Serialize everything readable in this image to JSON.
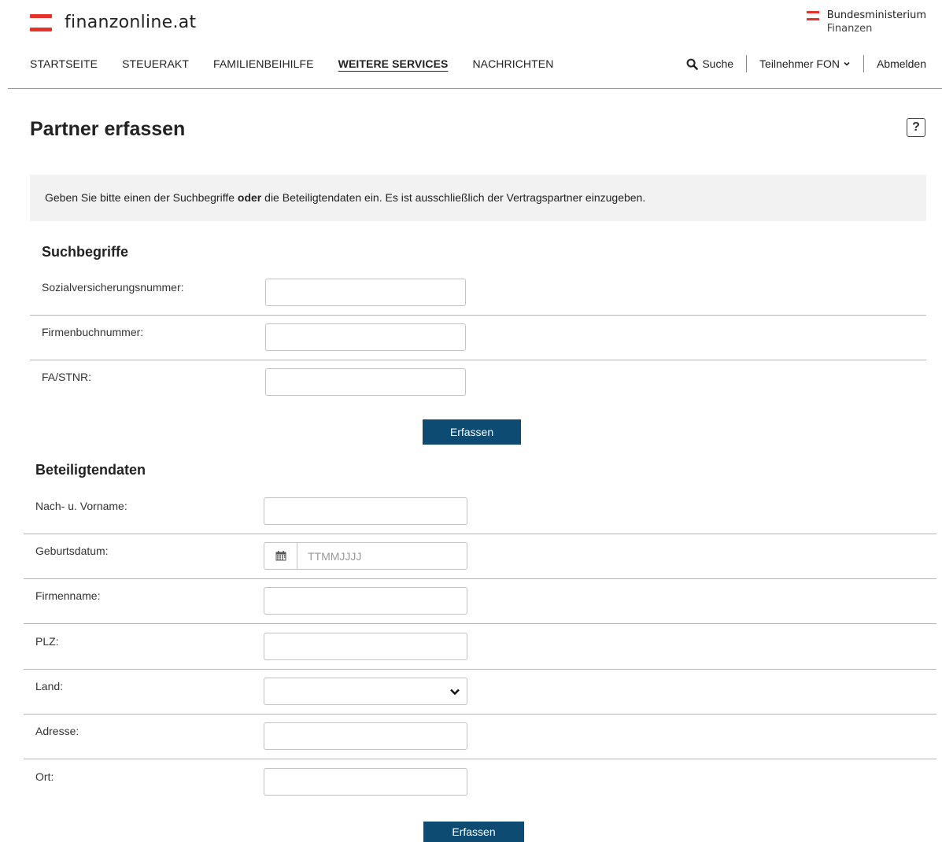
{
  "header": {
    "logo_text": "finanzonline.at",
    "ministry_line1": "Bundesministerium",
    "ministry_line2": "Finanzen",
    "brand_color": "#e6322b"
  },
  "nav": {
    "items": [
      "STARTSEITE",
      "STEUERAKT",
      "FAMILIENBEIHILFE",
      "WEITERE SERVICES",
      "NACHRICHTEN"
    ],
    "active": "WEITERE SERVICES",
    "search_label": "Suche",
    "user_label": "Teilnehmer FON",
    "logout_label": "Abmelden"
  },
  "page": {
    "title": "Partner erfassen",
    "help_label": "?",
    "info_part1": "Geben Sie bitte einen der Suchbegriffe ",
    "info_bold": "oder",
    "info_part2": " die Beteiligtendaten ein. Es ist ausschließlich der Vertragspartner einzugeben."
  },
  "suchbegriffe": {
    "title": "Suchbegriffe",
    "fields": [
      {
        "label": "Sozialversicherungsnummer:",
        "value": ""
      },
      {
        "label": "Firmenbuchnummer:",
        "value": ""
      },
      {
        "label": "FA/STNR:",
        "value": ""
      }
    ],
    "submit_label": "Erfassen"
  },
  "beteiligtendaten": {
    "title": "Beteiligtendaten",
    "fields": [
      {
        "label": "Nach- u. Vorname:",
        "value": ""
      },
      {
        "label": "Geburtsdatum:",
        "placeholder": "TTMMJJJJ",
        "value": ""
      },
      {
        "label": "Firmenname:",
        "value": ""
      },
      {
        "label": "PLZ:",
        "value": ""
      },
      {
        "label": "Land:",
        "value": ""
      },
      {
        "label": "Adresse:",
        "value": ""
      },
      {
        "label": "Ort:",
        "value": ""
      }
    ],
    "submit_label": "Erfassen"
  },
  "colors": {
    "button": "#0e4b73",
    "info_background": "#f2f2f2"
  }
}
